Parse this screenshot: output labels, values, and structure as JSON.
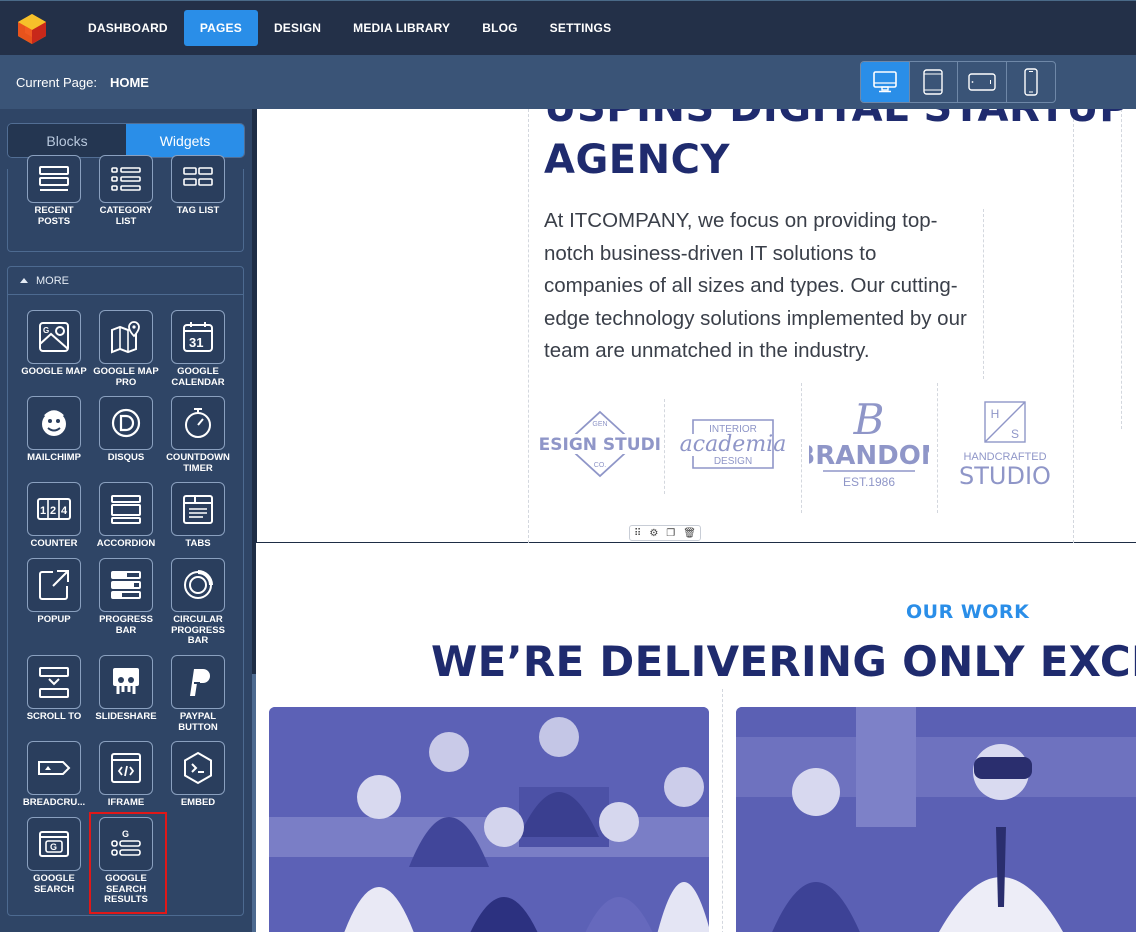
{
  "nav": {
    "items": [
      {
        "label": "DASHBOARD",
        "active": false
      },
      {
        "label": "PAGES",
        "active": true
      },
      {
        "label": "DESIGN",
        "active": false
      },
      {
        "label": "MEDIA LIBRARY",
        "active": false
      },
      {
        "label": "BLOG",
        "active": false
      },
      {
        "label": "SETTINGS",
        "active": false
      }
    ]
  },
  "subbar": {
    "current_label": "Current Page:",
    "current_value": "HOME",
    "devices": [
      "desktop-icon",
      "tablet-icon",
      "tablet-landscape-icon",
      "mobile-icon"
    ]
  },
  "sidebar": {
    "tabs": [
      {
        "label": "Blocks"
      },
      {
        "label": "Widgets"
      }
    ],
    "top_widgets": [
      {
        "label": "RECENT POSTS",
        "icon": "recent-posts-icon"
      },
      {
        "label": "CATEGORY LIST",
        "icon": "category-list-icon"
      },
      {
        "label": "TAG LIST",
        "icon": "tag-list-icon"
      }
    ],
    "more_label": "MORE",
    "more_widgets": [
      {
        "label": "GOOGLE MAP"
      },
      {
        "label": "GOOGLE MAP PRO"
      },
      {
        "label": "GOOGLE CALENDAR"
      },
      {
        "label": "MAILCHIMP"
      },
      {
        "label": "DISQUS"
      },
      {
        "label": "COUNTDOWN TIMER"
      },
      {
        "label": "COUNTER"
      },
      {
        "label": "ACCORDION"
      },
      {
        "label": "TABS"
      },
      {
        "label": "POPUP"
      },
      {
        "label": "PROGRESS BAR"
      },
      {
        "label": "CIRCULAR PROGRESS BAR"
      },
      {
        "label": "SCROLL TO"
      },
      {
        "label": "SLIDESHARE"
      },
      {
        "label": "PAYPAL BUTTON"
      },
      {
        "label": "BREADCRU..."
      },
      {
        "label": "IFRAME"
      },
      {
        "label": "EMBED"
      },
      {
        "label": "GOOGLE SEARCH"
      },
      {
        "label": "GOOGLE SEARCH RESULTS"
      }
    ]
  },
  "canvas": {
    "hero_title_line1": "USPINS DIGITAL STARTUP",
    "hero_title_line2": "AGENCY",
    "hero_text": "At ITCOMPANY, we focus on providing top-notch business-driven IT solutions to companies of all sizes and types. Our cutting-edge technology solutions implemented by our team are unmatched in the industry.",
    "brands": {
      "b1_top": "GEN",
      "b1_main": "DESIGN STUDIO",
      "b1_bottom": "CO.",
      "b2_top": "INTERIOR",
      "b2_main": "academia",
      "b2_bottom": "DESIGN",
      "b3_letter": "B",
      "b3_main": "BRANDON",
      "b3_bottom": "EST.1986",
      "b4_h": "H",
      "b4_s": "S",
      "b4_top": "HANDCRAFTED",
      "b4_main": "STUDIO"
    },
    "section_label": "OUR WORK",
    "section_title": "WE’RE DELIVERING ONLY EXCEPTIONAL"
  },
  "colors": {
    "accent": "#2a8ee8",
    "navy": "#1f2b6e",
    "highlight": "#e01818"
  }
}
